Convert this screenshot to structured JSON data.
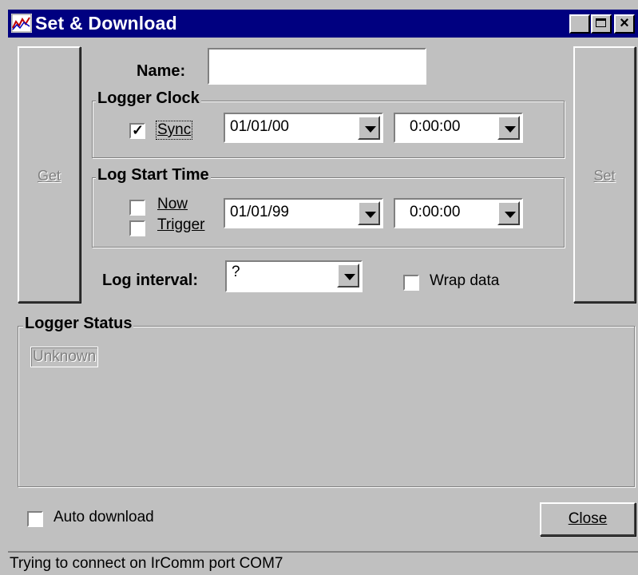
{
  "window": {
    "title": "Set & Download"
  },
  "controls": {
    "get_button": "Get",
    "set_button": "Set",
    "name_label": "Name:",
    "name_value": ""
  },
  "logger_clock": {
    "title": "Logger Clock",
    "sync_label": "Sync",
    "sync_checked": true,
    "date": "01/01/00",
    "time": "0:00:00"
  },
  "log_start": {
    "title": "Log Start Time",
    "now_label": "Now",
    "trigger_label": "Trigger",
    "date": "01/01/99",
    "time": "0:00:00"
  },
  "log_interval": {
    "label": "Log interval:",
    "value": "?"
  },
  "wrap_data": {
    "label": "Wrap data",
    "checked": false
  },
  "logger_status": {
    "title": "Logger Status",
    "value": "Unknown"
  },
  "auto_download": {
    "label": "Auto download",
    "checked": false
  },
  "close_button": "Close",
  "statusbar": {
    "text": "Trying to connect on IrComm port COM7"
  }
}
